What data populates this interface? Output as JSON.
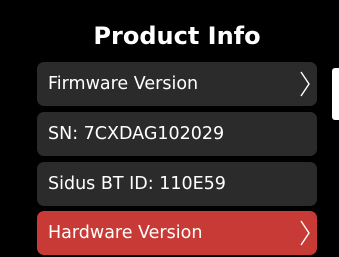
{
  "header": {
    "title": "Product Info"
  },
  "menu": {
    "items": [
      {
        "label": "Firmware Version",
        "has_chevron": true,
        "selected": false
      },
      {
        "label": "SN: 7CXDAG102029",
        "has_chevron": false,
        "selected": false
      },
      {
        "label": "Sidus BT ID: 110E59",
        "has_chevron": false,
        "selected": false
      },
      {
        "label": "Hardware Version",
        "has_chevron": true,
        "selected": true
      }
    ]
  },
  "icons": {
    "chevron": "chevron-right-icon"
  },
  "colors": {
    "background": "#000000",
    "row": "#2b2b2b",
    "selected_row": "#c73a35",
    "text": "#ffffff"
  }
}
